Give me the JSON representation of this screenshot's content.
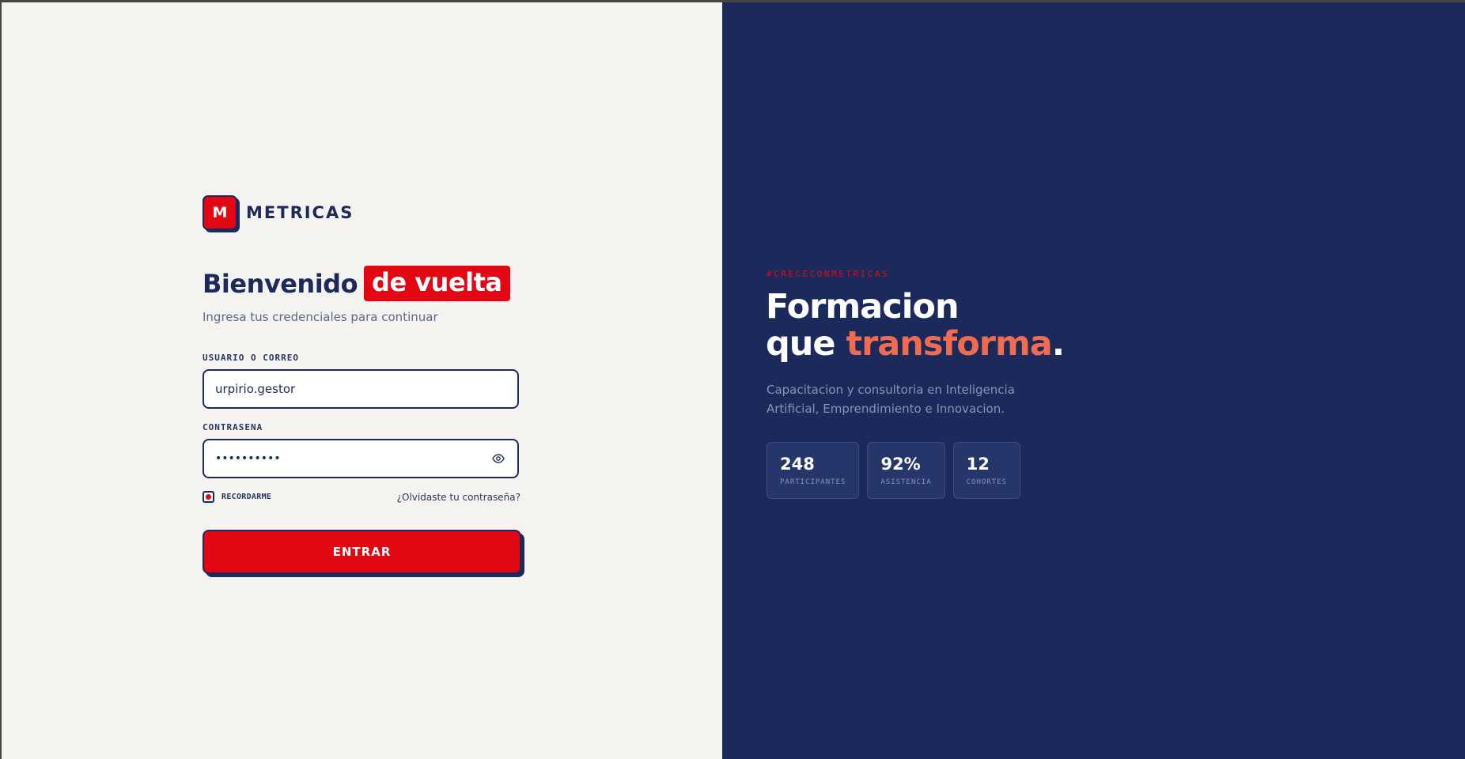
{
  "brand": {
    "logo_letter": "M",
    "name": "METRICAS"
  },
  "login": {
    "heading": "Bienvenido",
    "heading_highlight": "de vuelta",
    "subtitle": "Ingresa tus credenciales para continuar",
    "username_label": "USUARIO O CORREO",
    "username_value": "urpirio.gestor",
    "password_label": "CONTRASENA",
    "password_mask": "••••••••••",
    "remember_label": "RECORDARME",
    "forgot_link": "¿Olvidaste tu contraseña?",
    "submit_label": "ENTRAR"
  },
  "promo": {
    "hashtag": "#CRECECONMETRICAS",
    "title_line1": "Formacion",
    "title_line2_prefix": "que ",
    "title_accent": "transforma",
    "title_suffix": ".",
    "description": "Capacitacion y consultoria en Inteligencia Artificial, Emprendimiento e Innovacion.",
    "stats": [
      {
        "value": "248",
        "label": "PARTICIPANTES"
      },
      {
        "value": "92%",
        "label": "ASISTENCIA"
      },
      {
        "value": "12",
        "label": "COHORTES"
      }
    ]
  },
  "colors": {
    "brand_red": "#e30613",
    "navy": "#1c2a5b",
    "accent_orange": "#f26b4f",
    "left_background": "#f4f3f0"
  },
  "icons": {
    "password_toggle": "eye-icon"
  }
}
